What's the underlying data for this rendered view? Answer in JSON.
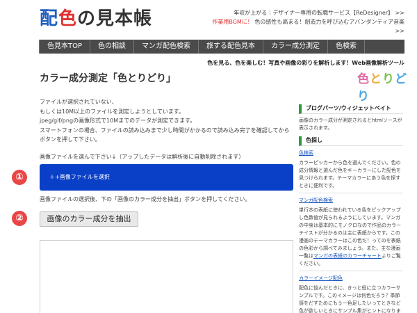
{
  "header": {
    "logo": {
      "part1": "配",
      "part2": "色",
      "part3": "の見本帳"
    },
    "promo_line1": "年収が上がる｜デザイナー専用の転職サービス【ReDesigner】 >>",
    "promo_line2_highlight": "作業用BGMに！",
    "promo_line2_rest": "色の感性も高まる！創造力を呼び込むアバンダンティア音楽",
    "promo_line2_arrow": ">>"
  },
  "nav": {
    "items": [
      "色見本TOP",
      "色の相談",
      "マンガ配色検索",
      "旅する配色見本",
      "カラー成分測定",
      "色検索"
    ]
  },
  "tagline": "色を見る、色を楽しむ！写真や画像の彩りを解析します！Web画像解析ツール",
  "page": {
    "title": "カラー成分測定「色とりどり」",
    "brand_logo": [
      "色",
      "と",
      "り",
      "どり"
    ]
  },
  "main": {
    "notice": [
      "ファイルが選択されていない、",
      "もしくは10M以上のファイルを測定しようとしています。",
      "jpeg/gif/pngの画像形式で10Mまでのデータが測定できます。",
      "スマートフォンの場合、ファイルの読み込みまで少し時間がかかるので読み込み完了を確認してから",
      "ボタンを押して下さい。"
    ],
    "instruction1": "画像ファイルを選んで下さい↓（アップしたデータは解析後に自動削除されます）",
    "upload_label": "＋+画像ファイルを選択",
    "instruction2": "画像ファイルの選択後、下の「画像のカラー成分を抽出」ボタンを押してください。",
    "extract_label": "画像のカラー成分を抽出",
    "step1": "①",
    "step2": "②"
  },
  "sidebar": {
    "section_title": "ブログパーツ/ウィジェットベイト",
    "section_desc": "画像のカラー成分が測定されるとhtmlソースが表示されます。",
    "sub_title": "色探し",
    "links": [
      {
        "label": "色検索",
        "desc": "カラーピッカーから色を選んでください。色の成分情報と選んだ色をキーカラーにした配色を見つけられます。テーマカラーにあう色を探すときに便利です。"
      },
      {
        "label": "マンガ配色検索",
        "desc_before": "単行本の表紙に使われている色をピックアップし色数値が見られるようにしています。マンガの中身は基本的にモノクロなので作品のカラーテイストが分かるのは主に表紙からです。この漫画のテーマカラーはこの色だ！ってのを表紙の色彩から調べてみましょう。また、主な漫画一覧は",
        "inline_link": "マンガの表紙のカラーチャート",
        "desc_after": "よりご覧ください。"
      },
      {
        "label": "カラーイメージ配色",
        "desc": "配色に悩んだときに、きっと役に立つカラーサンプルです。このイメージは何色だろう？季節感をだすためにもう一色足したいってときなど色が欲しいときにサンプル集がヒントになります。"
      }
    ]
  },
  "colors": {
    "nav_bg": "#4a4a4a",
    "upload_button": "#0a3fc8",
    "step_badge": "#e94646",
    "sidebar_accent": "#2e9b3e",
    "link": "#1a55c0"
  }
}
